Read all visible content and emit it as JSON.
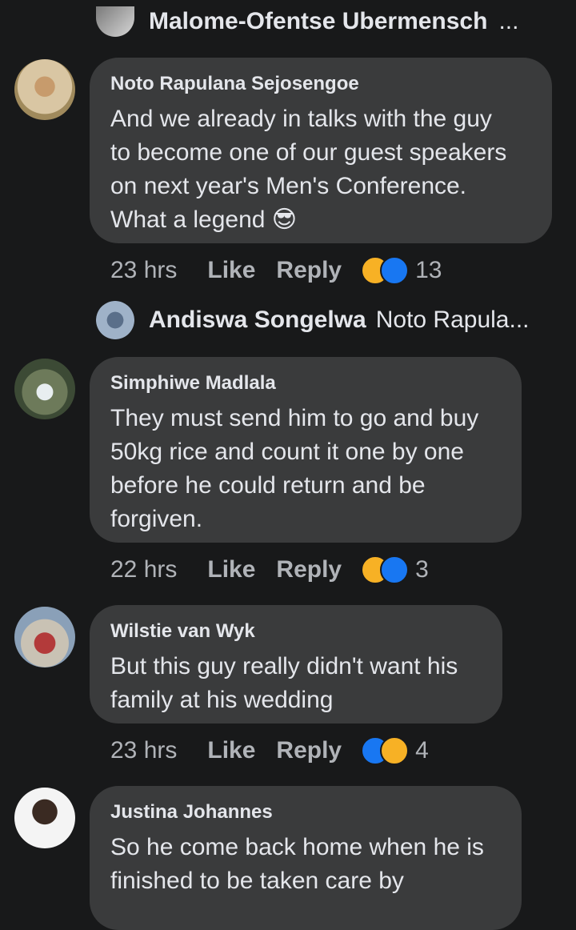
{
  "top_reply": {
    "name": "Malome-Ofentse Ubermensch",
    "ellipsis": "..."
  },
  "comments": [
    {
      "author": "Noto Rapulana Sejosengoe",
      "lines": [
        "And we already in talks with the guy",
        "to become one of our guest speakers",
        "on next year's Men's Conference.",
        "What a legend 😎"
      ],
      "time": "23 hrs",
      "like": "Like",
      "reply": "Reply",
      "reaction_count": "13"
    },
    {
      "author": "Simphiwe Madlala",
      "lines": [
        "They must send him to go and buy",
        "50kg rice and count it one by one",
        "before he could return and be",
        "forgiven."
      ],
      "time": "22 hrs",
      "like": "Like",
      "reply": "Reply",
      "reaction_count": "3"
    },
    {
      "author": "Wilstie van Wyk",
      "lines": [
        "But this guy really didn't want his",
        "family at his wedding"
      ],
      "time": "23 hrs",
      "like": "Like",
      "reply": "Reply",
      "reaction_count": "4"
    },
    {
      "author": "Justina Johannes",
      "lines": [
        "So he come back home when he is",
        "finished to be taken care by"
      ]
    }
  ],
  "nested_reply": {
    "name": "Andiswa Songelwa",
    "snippet": "Noto Rapula..."
  },
  "colors": {
    "background": "#18191a",
    "bubble": "#3a3b3c",
    "primary_text": "#e4e6eb",
    "secondary_text": "#b0b3b8",
    "like_blue": "#1877f2",
    "haha_yellow": "#f7b125"
  },
  "icons": [
    "haha-reaction-icon",
    "like-reaction-icon",
    "sunglasses-emoji-icon"
  ]
}
